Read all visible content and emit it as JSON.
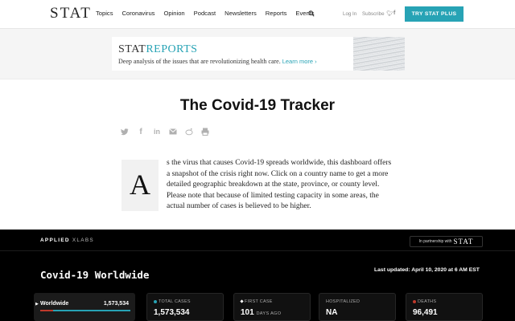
{
  "header": {
    "logo": "STAT",
    "nav": [
      "Topics",
      "Coronavirus",
      "Opinion",
      "Podcast",
      "Newsletters",
      "Reports",
      "Events"
    ],
    "login": "Log In",
    "subscribe": "Subscribe",
    "cta": "TRY STAT PLUS"
  },
  "banner": {
    "brand_a": "STAT",
    "brand_b": "REPORTS",
    "tagline": "Deep analysis of the issues that are revolutionizing health care.",
    "link": "Learn more ›"
  },
  "article": {
    "title": "The Covid-19 Tracker",
    "dropcap": "A",
    "intro": "s the virus that causes Covid-19 spreads worldwide, this dashboard offers a snapshot of the crisis right now. Click on a country name to get a more detailed geographic breakdown at the state, province, or county level. Please note that because of limited testing capacity in some areas, the actual number of cases is believed to be higher."
  },
  "dashboard": {
    "brand": "APPLIED",
    "brand_x": "XLABS",
    "partner_text": "In partnership with",
    "partner_brand": "STAT",
    "title": "Covid-19 Worldwide",
    "updated": "Last updated: April 10, 2020 at 6 AM EST",
    "region": {
      "label": "Worldwide",
      "value": "1,573,534"
    },
    "cards": [
      {
        "label": "TOTAL CASES",
        "value": "1,573,534",
        "unit": "",
        "color": "#27a3b5"
      },
      {
        "label": "FIRST CASE",
        "value": "101",
        "unit": "DAYS AGO",
        "color": "#ffffff"
      },
      {
        "label": "HOSPITALIZED",
        "value": "NA",
        "unit": "",
        "color": ""
      },
      {
        "label": "DEATHS",
        "value": "96,491",
        "unit": "",
        "color": "#c0392b"
      }
    ]
  },
  "colors": {
    "accent": "#27a3b5",
    "deaths": "#c0392b"
  }
}
